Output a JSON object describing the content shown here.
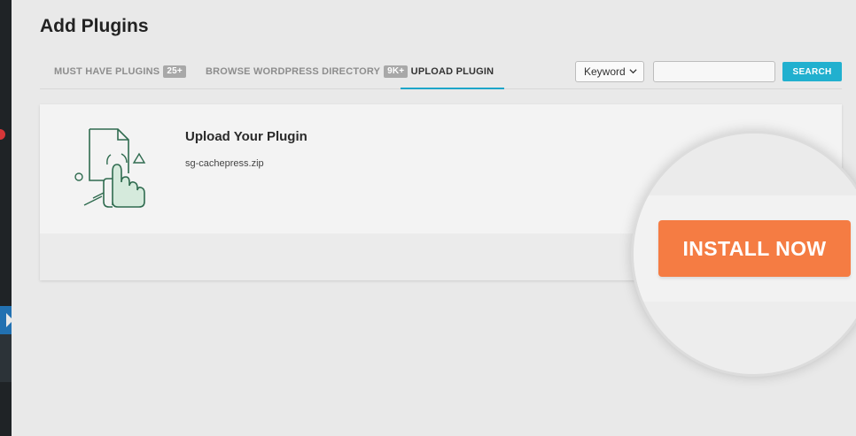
{
  "page": {
    "title": "Add Plugins"
  },
  "tabs": [
    {
      "label": "MUST HAVE PLUGINS",
      "badge": "25+"
    },
    {
      "label": "BROWSE WORDPRESS DIRECTORY",
      "badge": "9K+"
    },
    {
      "label": "UPLOAD PLUGIN"
    }
  ],
  "search": {
    "type_selected": "Keyword",
    "query": "",
    "button_label": "SEARCH"
  },
  "upload": {
    "title": "Upload Your Plugin",
    "file_name": "sg-cachepress.zip",
    "install_label": "INSTALL NOW"
  },
  "colors": {
    "accent": "#21b0cf",
    "install": "#f57c43",
    "icon_stroke": "#2f6b4f",
    "icon_fill": "#d5eadc"
  },
  "icons": {
    "plugin_upload": "hand-tap-document-icon",
    "select_caret": "chevron-down-icon"
  }
}
